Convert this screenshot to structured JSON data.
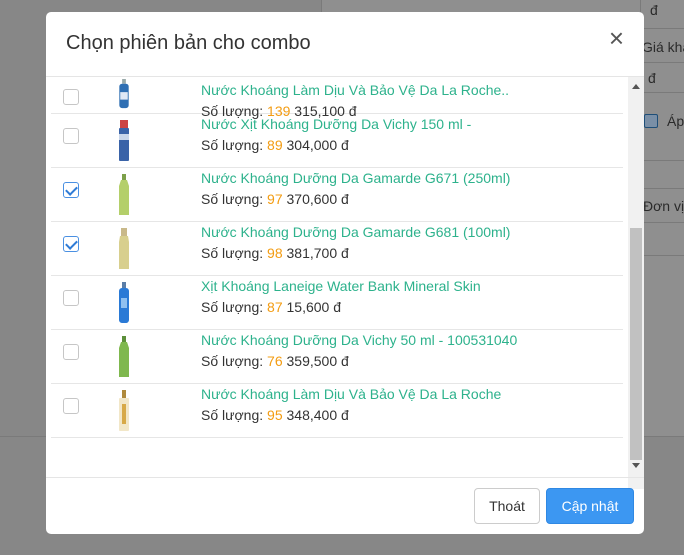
{
  "background": {
    "texts": [
      "đ",
      "đ",
      "đ",
      "Giá khá",
      "Áp",
      "Đơn vị"
    ]
  },
  "modal": {
    "title": "Chọn phiên bản cho combo",
    "close_label": "×",
    "qty_label": "Số lượng:",
    "items": [
      {
        "name": "Nước Khoáng Làm Dịu Và Bảo Vệ Da La Roche..",
        "qty": "139",
        "price": "315,100 đ",
        "checked": false
      },
      {
        "name": "Nước Xịt Khoáng Dưỡng Da Vichy 150 ml -",
        "qty": "89",
        "price": "304,000 đ",
        "checked": false
      },
      {
        "name": "Nước Khoáng Dưỡng Da Gamarde G671 (250ml)",
        "qty": "97",
        "price": "370,600 đ",
        "checked": true
      },
      {
        "name": "Nước Khoáng Dưỡng Da Gamarde G681 (100ml)",
        "qty": "98",
        "price": "381,700 đ",
        "checked": true
      },
      {
        "name": "Xịt Khoáng Laneige Water Bank Mineral Skin",
        "qty": "87",
        "price": "15,600 đ",
        "checked": false
      },
      {
        "name": "Nước Khoáng Dưỡng Da Vichy 50 ml - 100531040",
        "qty": "76",
        "price": "359,500 đ",
        "checked": false
      },
      {
        "name": "Nước Khoáng Làm Dịu Và Bảo Vệ Da La Roche",
        "qty": "95",
        "price": "348,400 đ",
        "checked": false
      }
    ],
    "footer": {
      "exit_label": "Thoát",
      "update_label": "Cập nhật"
    },
    "colors": {
      "product_name": "#2db28c",
      "quantity": "#f39c12",
      "primary_button": "#3c97f2"
    }
  }
}
